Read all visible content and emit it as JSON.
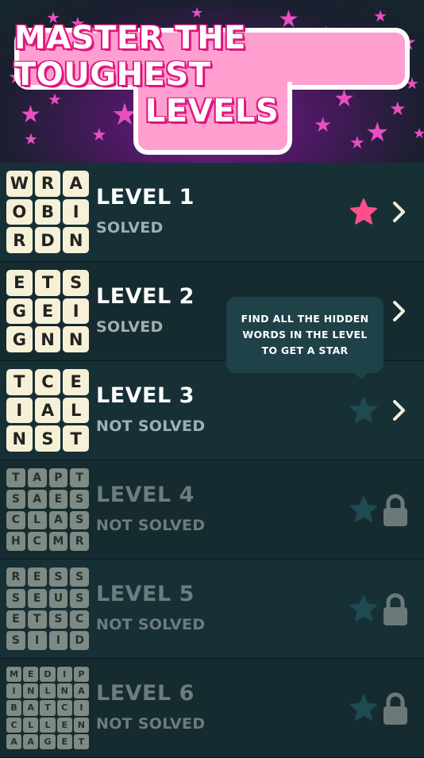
{
  "banner": {
    "line1": "MASTER THE TOUGHEST",
    "line2": "LEVELS"
  },
  "tooltip": {
    "text": "FIND ALL THE HIDDEN WORDS IN THE LEVEL TO GET A STAR"
  },
  "colors": {
    "background": "#14262b",
    "tile": "#f6f1d6",
    "locked_tile": "#7e8a84",
    "star_earned": "#ff4f8b",
    "star_empty": "#1e4a52",
    "headline_outline": "#e0157e"
  },
  "levels": [
    {
      "title": "LEVEL 1",
      "status": "SOLVED",
      "star_earned": true,
      "locked": false,
      "icon": "chevron-right-icon",
      "grid": [
        "W",
        "R",
        "A",
        "O",
        "B",
        "I",
        "R",
        "D",
        "N"
      ]
    },
    {
      "title": "LEVEL 2",
      "status": "SOLVED",
      "star_earned": false,
      "locked": false,
      "icon": "chevron-right-icon",
      "grid": [
        "E",
        "T",
        "S",
        "G",
        "E",
        "I",
        "G",
        "N",
        "N"
      ]
    },
    {
      "title": "LEVEL 3",
      "status": "NOT SOLVED",
      "star_earned": false,
      "locked": false,
      "icon": "chevron-right-icon",
      "grid": [
        "T",
        "C",
        "E",
        "I",
        "A",
        "L",
        "N",
        "S",
        "T"
      ]
    },
    {
      "title": "LEVEL 4",
      "status": "NOT SOLVED",
      "star_earned": false,
      "locked": true,
      "icon": "lock-icon",
      "grid": [
        "T",
        "A",
        "P",
        "T",
        "S",
        "A",
        "E",
        "S",
        "C",
        "L",
        "A",
        "S",
        "H",
        "C",
        "M",
        "R"
      ]
    },
    {
      "title": "LEVEL 5",
      "status": "NOT SOLVED",
      "star_earned": false,
      "locked": true,
      "icon": "lock-icon",
      "grid": [
        "R",
        "E",
        "S",
        "S",
        "S",
        "E",
        "U",
        "S",
        "E",
        "T",
        "S",
        "C",
        "S",
        "I",
        "I",
        "D"
      ]
    },
    {
      "title": "LEVEL 6",
      "status": "NOT SOLVED",
      "star_earned": false,
      "locked": true,
      "icon": "lock-icon",
      "grid": [
        "M",
        "E",
        "D",
        "I",
        "P",
        "I",
        "N",
        "L",
        "N",
        "A",
        "B",
        "A",
        "T",
        "C",
        "I",
        "C",
        "L",
        "L",
        "E",
        "N",
        "A",
        "A",
        "G",
        "E",
        "T"
      ]
    }
  ]
}
